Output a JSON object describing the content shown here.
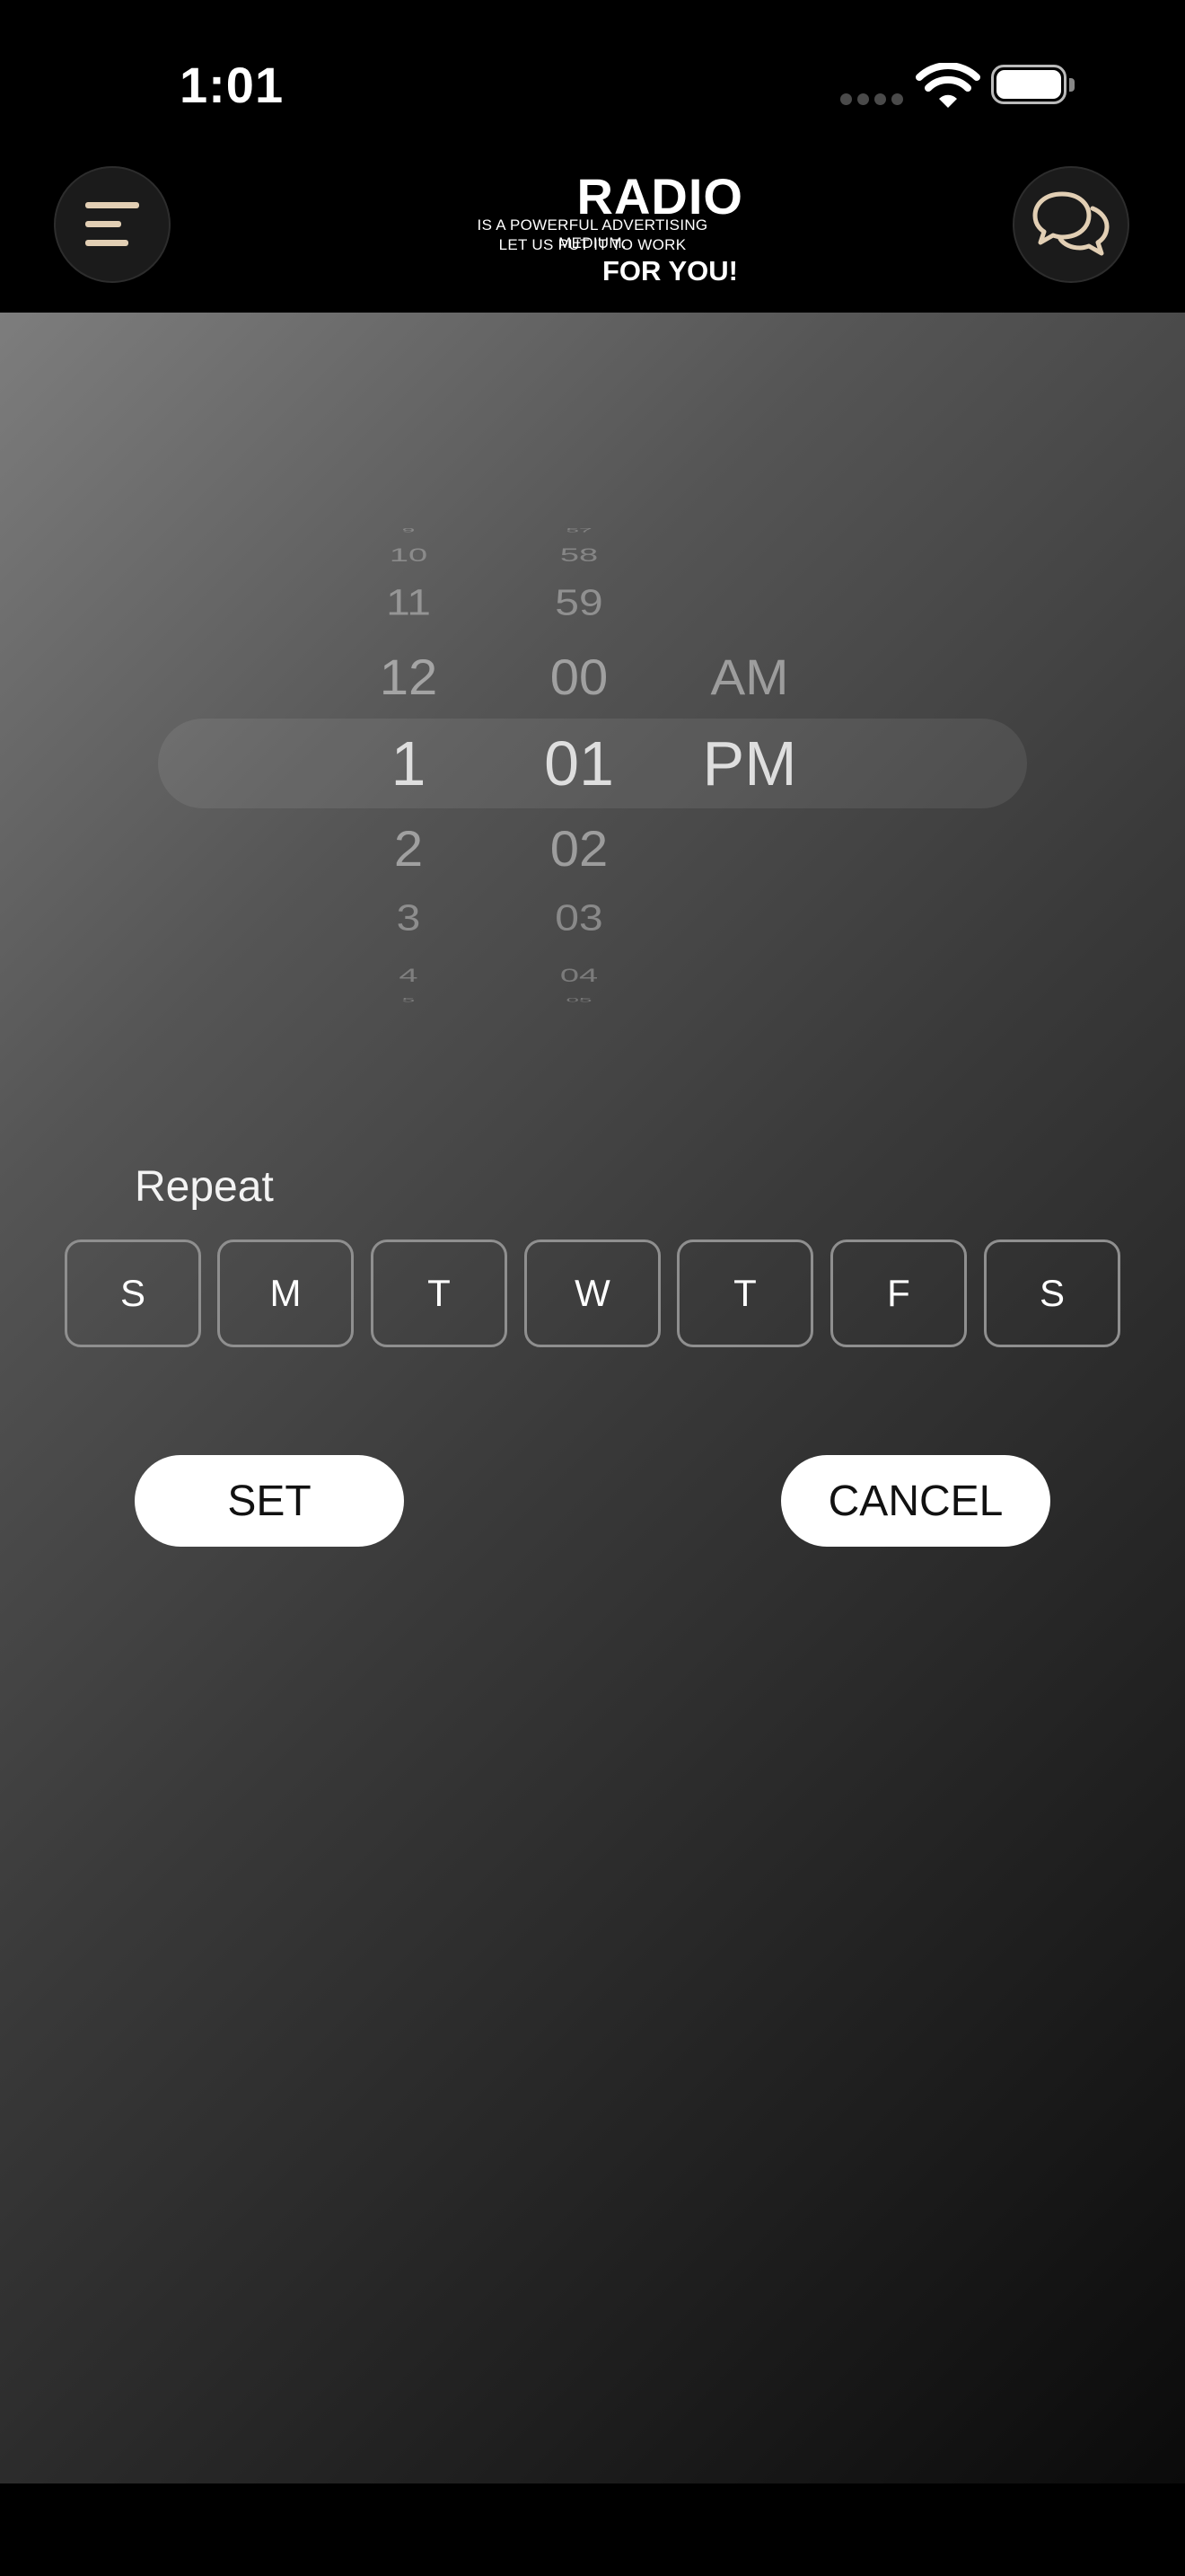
{
  "status_bar": {
    "time": "1:01"
  },
  "header": {
    "menu_icon": "menu-lines-icon",
    "chat_icon": "chat-bubbles-icon",
    "logo": {
      "title": "RADIO",
      "line1": "IS A POWERFUL ADVERTISING MEDIUM.",
      "line2": "LET US PUT IT TO WORK",
      "line3": "FOR YOU!"
    },
    "accent_color": "#e2cfb4"
  },
  "time_picker": {
    "hours": [
      "9",
      "10",
      "11",
      "12",
      "1",
      "2",
      "3",
      "4",
      "5"
    ],
    "minutes": [
      "57",
      "58",
      "59",
      "00",
      "01",
      "02",
      "03",
      "04",
      "05"
    ],
    "periods": [
      "AM",
      "PM"
    ],
    "selected": {
      "hour": "1",
      "minute": "01",
      "period": "PM"
    }
  },
  "repeat": {
    "label": "Repeat",
    "days": [
      "S",
      "M",
      "T",
      "W",
      "T",
      "F",
      "S"
    ]
  },
  "actions": {
    "set_label": "SET",
    "cancel_label": "CANCEL"
  }
}
